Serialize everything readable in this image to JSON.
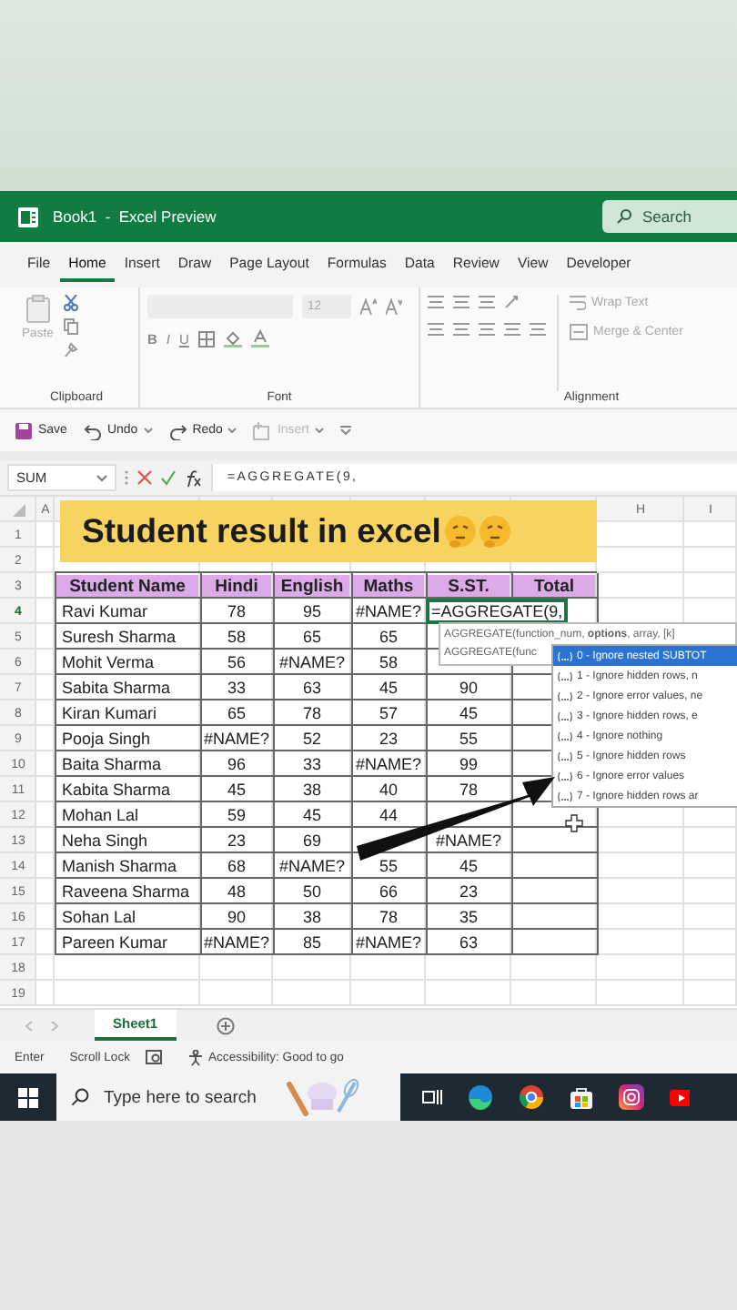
{
  "window": {
    "title": "Book1  -  Excel Preview",
    "search": {
      "placeholder": "Search"
    }
  },
  "tabs": [
    {
      "label": "File",
      "selected": false
    },
    {
      "label": "Home",
      "selected": true
    },
    {
      "label": "Insert",
      "selected": false
    },
    {
      "label": "Draw",
      "selected": false
    },
    {
      "label": "Page Layout",
      "selected": false
    },
    {
      "label": "Formulas",
      "selected": false
    },
    {
      "label": "Data",
      "selected": false
    },
    {
      "label": "Review",
      "selected": false
    },
    {
      "label": "View",
      "selected": false
    },
    {
      "label": "Developer",
      "selected": false
    }
  ],
  "ribbon": {
    "clipboard": {
      "label": "Clipboard",
      "paste": "Paste"
    },
    "font": {
      "label": "Font",
      "size": "12",
      "styles": [
        "B",
        "I",
        "U"
      ]
    },
    "alignment": {
      "label": "Alignment",
      "wrap": "Wrap Text",
      "merge": "Merge & Center"
    }
  },
  "quick_access": [
    {
      "label": "Save",
      "kind": "save",
      "disabled": false
    },
    {
      "label": "Undo",
      "kind": "undo",
      "disabled": false
    },
    {
      "label": "Redo",
      "kind": "redo",
      "disabled": false
    },
    {
      "label": "Insert",
      "kind": "insert",
      "disabled": true
    }
  ],
  "formula_bar": {
    "name_box": "SUM",
    "formula": "=AGGREGATE(9,"
  },
  "sheet": {
    "column_headers": [
      "A",
      "H",
      "I"
    ],
    "banner": "Student result in excel",
    "rows": [
      {
        "number": "1",
        "kind": "blank"
      },
      {
        "number": "2",
        "kind": "blank"
      },
      {
        "number": "3",
        "kind": "header",
        "student": "Student Name",
        "hindi": "Hindi",
        "english": "English",
        "maths": "Maths",
        "sst": "S.ST.",
        "total": "Total"
      },
      {
        "number": "4",
        "kind": "data",
        "editing": true,
        "student": "Ravi Kumar",
        "hindi": "78",
        "english": "95",
        "maths": "#NAME?",
        "sst": "=AGGREGATE(9,"
      },
      {
        "number": "5",
        "kind": "data",
        "editing": false,
        "student": "Suresh Sharma",
        "hindi": "58",
        "english": "65",
        "maths": "65"
      },
      {
        "number": "6",
        "kind": "data",
        "editing": false,
        "student": "Mohit Verma",
        "hindi": "56",
        "english": "#NAME?",
        "maths": "58"
      },
      {
        "number": "7",
        "kind": "data",
        "editing": false,
        "student": "Sabita Sharma",
        "hindi": "33",
        "english": "63",
        "maths": "45",
        "sst": "90"
      },
      {
        "number": "8",
        "kind": "data",
        "editing": false,
        "student": "Kiran Kumari",
        "hindi": "65",
        "english": "78",
        "maths": "57",
        "sst": "45"
      },
      {
        "number": "9",
        "kind": "data",
        "editing": false,
        "student": "Pooja Singh",
        "hindi": "#NAME?",
        "english": "52",
        "maths": "23",
        "sst": "55"
      },
      {
        "number": "10",
        "kind": "data",
        "editing": false,
        "student": "Baita Sharma",
        "hindi": "96",
        "english": "33",
        "maths": "#NAME?",
        "sst": "99"
      },
      {
        "number": "11",
        "kind": "data",
        "editing": false,
        "student": "Kabita Sharma",
        "hindi": "45",
        "english": "38",
        "maths": "40",
        "sst": "78"
      },
      {
        "number": "12",
        "kind": "data",
        "editing": false,
        "student": "Mohan Lal",
        "hindi": "59",
        "english": "45",
        "maths": "44"
      },
      {
        "number": "13",
        "kind": "data",
        "editing": false,
        "student": "Neha Singh",
        "hindi": "23",
        "english": "69",
        "sst": "#NAME?"
      },
      {
        "number": "14",
        "kind": "data",
        "editing": false,
        "student": "Manish Sharma",
        "hindi": "68",
        "english": "#NAME?",
        "maths": "55",
        "sst": "45"
      },
      {
        "number": "15",
        "kind": "data",
        "editing": false,
        "student": "Raveena Sharma",
        "hindi": "48",
        "english": "50",
        "maths": "66",
        "sst": "23"
      },
      {
        "number": "16",
        "kind": "data",
        "editing": false,
        "student": "Sohan Lal",
        "hindi": "90",
        "english": "38",
        "maths": "78",
        "sst": "35"
      },
      {
        "number": "17",
        "kind": "data",
        "editing": false,
        "student": "Pareen Kumar",
        "hindi": "#NAME?",
        "english": "85",
        "maths": "#NAME?",
        "sst": "63"
      },
      {
        "number": "18",
        "kind": "blank"
      },
      {
        "number": "19",
        "kind": "blank"
      }
    ],
    "tooltip": [
      "AGGREGATE(function_num, **options**, array, [k]",
      "AGGREGATE(func"
    ],
    "autocomplete": [
      {
        "label": "0 - Ignore nested SUBTOT",
        "selected": true
      },
      {
        "label": "1 - Ignore hidden rows, n",
        "selected": false
      },
      {
        "label": "2 - Ignore error values, ne",
        "selected": false
      },
      {
        "label": "3 - Ignore hidden rows, e",
        "selected": false
      },
      {
        "label": "4 - Ignore nothing",
        "selected": false
      },
      {
        "label": "5 - Ignore hidden rows",
        "selected": false
      },
      {
        "label": "6 - Ignore error values",
        "selected": false
      },
      {
        "label": "7 - Ignore hidden rows ar",
        "selected": false
      }
    ]
  },
  "sheet_tabs": [
    {
      "label": "Sheet1",
      "selected": true
    }
  ],
  "status_bar": {
    "mode": "Enter",
    "scroll_lock": "Scroll Lock",
    "accessibility": "Accessibility: Good to go"
  },
  "taskbar": {
    "search": {
      "placeholder": "Type here to search"
    }
  }
}
